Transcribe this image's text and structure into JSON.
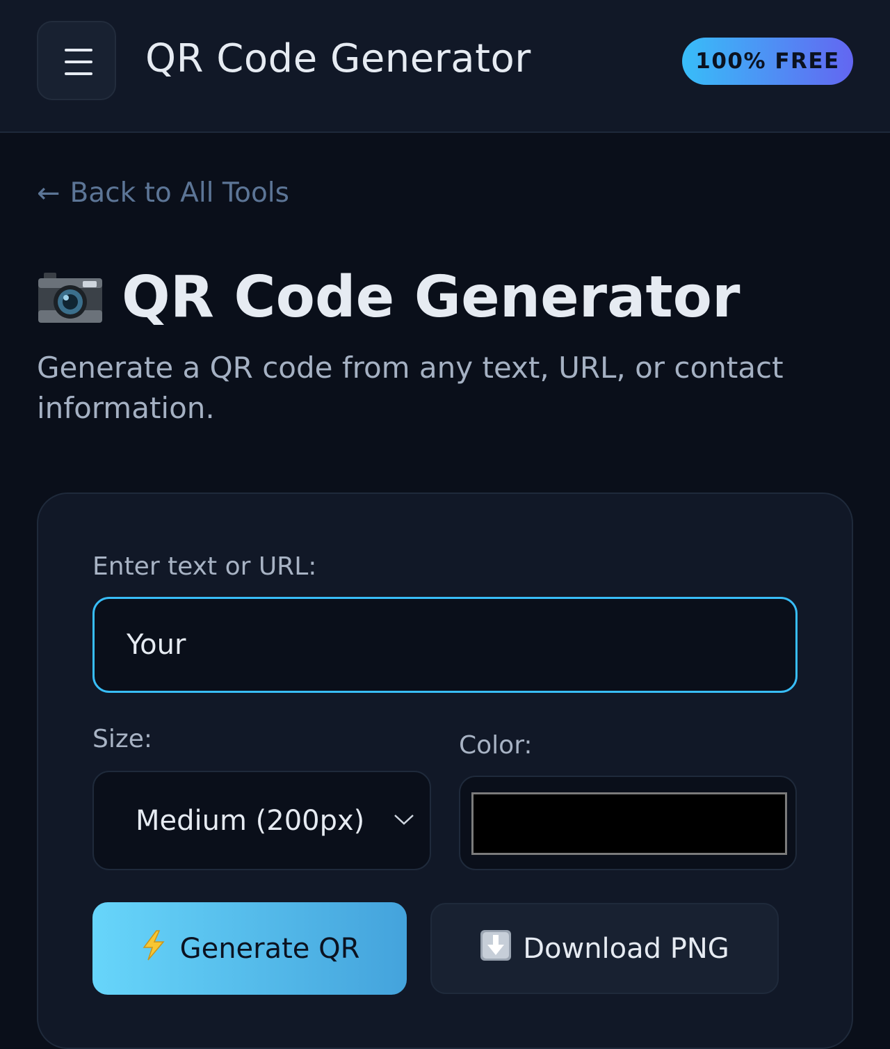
{
  "header": {
    "menu_icon": "hamburger-menu-icon",
    "title": "QR Code Generator",
    "badge": "100% FREE"
  },
  "nav": {
    "back_arrow": "←",
    "back_label": "Back to All Tools"
  },
  "page": {
    "title_icon": "camera-icon",
    "title": "QR Code Generator",
    "subtitle": "Generate a QR code from any text, URL, or contact information."
  },
  "form": {
    "text_label": "Enter text or URL:",
    "text_value": "Your",
    "size_label": "Size:",
    "size_value": "Medium (200px)",
    "color_label": "Color:",
    "color_value": "#000000",
    "generate_icon": "lightning-bolt-icon",
    "generate_label": "Generate QR",
    "download_icon": "down-arrow-icon",
    "download_label": "Download PNG"
  },
  "colors": {
    "accent": "#38bdf8",
    "badge_gradient_start": "#38bdf8",
    "badge_gradient_end": "#6366f1",
    "background": "#0a0f1a",
    "surface": "#111827"
  }
}
